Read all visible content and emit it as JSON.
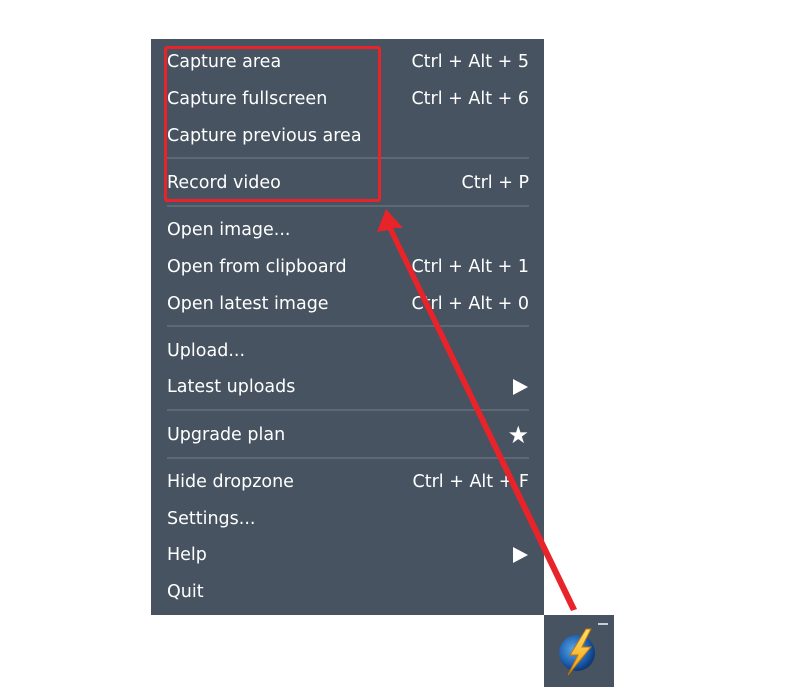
{
  "menu": {
    "items": [
      {
        "label": "Capture area",
        "shortcut": "Ctrl + Alt + 5"
      },
      {
        "label": "Capture fullscreen",
        "shortcut": "Ctrl + Alt + 6"
      },
      {
        "label": "Capture previous area",
        "shortcut": ""
      },
      {
        "label": "Record video",
        "shortcut": "Ctrl + P"
      },
      {
        "label": "Open image...",
        "shortcut": ""
      },
      {
        "label": "Open from clipboard",
        "shortcut": "Ctrl + Alt + 1"
      },
      {
        "label": "Open latest image",
        "shortcut": "Ctrl + Alt + 0"
      },
      {
        "label": "Upload...",
        "shortcut": ""
      },
      {
        "label": "Latest uploads",
        "icon": "submenu-arrow-icon"
      },
      {
        "label": "Upgrade plan",
        "icon": "star-icon"
      },
      {
        "label": "Hide dropzone",
        "shortcut": "Ctrl + Alt + F"
      },
      {
        "label": "Settings...",
        "shortcut": ""
      },
      {
        "label": "Help",
        "icon": "submenu-arrow-icon"
      },
      {
        "label": "Quit",
        "shortcut": ""
      }
    ]
  },
  "colors": {
    "menu_background": "#475360",
    "separator": "#5e6976",
    "text": "#ffffff",
    "annotation": "#e8232a"
  },
  "tray": {
    "icon": "lightning-bolt-app-icon"
  }
}
